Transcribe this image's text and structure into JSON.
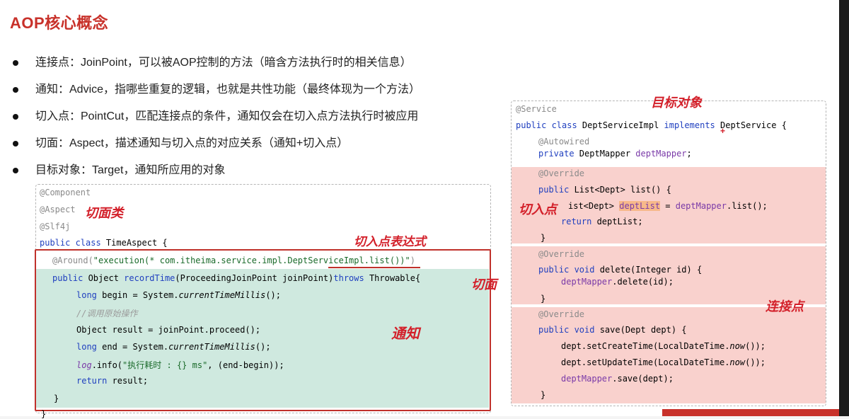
{
  "title": "AOP核心概念",
  "bullets": [
    "连接点：JoinPoint，可以被AOP控制的方法（暗含方法执行时的相关信息）",
    "通知：Advice，指哪些重复的逻辑，也就是共性功能（最终体现为一个方法）",
    "切入点：PointCut，匹配连接点的条件，通知仅会在切入点方法执行时被应用",
    "切面：Aspect，描述通知与切入点的对应关系（通知+切入点）",
    "目标对象：Target，通知所应用的对象"
  ],
  "left_code": {
    "component": "@Component",
    "aspect": "@Aspect",
    "slf4j": "@Slf4j",
    "class_kw": "public class",
    "class_name": " TimeAspect {",
    "around_prefix": "@Around(",
    "around_str1": "\"execution(* com.itheima.service.impl.",
    "around_str2": "DeptServiceImpl",
    "around_str3": ".list())\"",
    "around_suffix": ")",
    "m_kw": "public",
    "m_type": " Object ",
    "m_name": "recordTime",
    "m_params": "(ProceedingJoinPoint joinPoint)",
    "m_throws_kw": "throws",
    "m_throws": " Throwable{",
    "begin_kw": "long",
    "begin_a": " begin = System.",
    "begin_b": "currentTimeMillis",
    "begin_c": "();",
    "comment": "//调用原始操作",
    "proceed": "Object result = joinPoint.proceed();",
    "end_kw": "long",
    "end_a": " end = System.",
    "end_b": "currentTimeMillis",
    "end_c": "();",
    "log_a": "log",
    "log_b": ".info(",
    "log_str": "\"执行耗时 : {} ms\"",
    "log_c": ", (end-begin));",
    "ret_kw": "return",
    "ret": " result;",
    "close1": "}",
    "close2": "}"
  },
  "right_code": {
    "service": "@Service",
    "cls_kw": "public class",
    "cls_name": " DeptServiceImpl ",
    "cls_impl": "implements",
    "cls_iface": " DeptService {",
    "autowired": "@Autowired",
    "priv_kw": "private",
    "priv_type": " DeptMapper ",
    "priv_name": "deptMapper",
    "priv_end": ";",
    "ov1": "@Override",
    "list_kw": "public",
    "list_sig": " List<Dept> list() {",
    "list_body_a": "ist<Dept> ",
    "list_body_hl": "deptList",
    "list_body_b": " = ",
    "list_body_c": "deptMapper",
    "list_body_d": ".list();",
    "list_ret_kw": "return",
    "list_ret": " deptList;",
    "close_a": "}",
    "ov2": "@Override",
    "del_kw": "public void",
    "del_sig": " delete(Integer id) {",
    "del_body_a": "deptMapper",
    "del_body_b": ".delete(id);",
    "close_b": "}",
    "ov3": "@Override",
    "save_kw": "public void",
    "save_sig": " save(Dept dept) {",
    "save_1a": "dept.setCreateTime(LocalDateTime.",
    "save_1b": "now",
    "save_1c": "());",
    "save_2a": "dept.setUpdateTime(LocalDateTime.",
    "save_2b": "now",
    "save_2c": "());",
    "save_3a": "deptMapper",
    "save_3b": ".save(dept);",
    "close_c": "}"
  },
  "handwritten": {
    "aspect_class": "切面类",
    "pointcut_expr": "切入点表达式",
    "aspect": "切面",
    "advice": "通知",
    "target": "目标对象",
    "pointcut": "切入点",
    "joinpoint": "连接点",
    "plus": "+"
  },
  "colors": {
    "title": "#c8312a",
    "annotation": "#d3202a",
    "advice_bg": "#cfe9df",
    "joinpoint_bg": "#f9d1cd",
    "highlight": "#f7b98a"
  }
}
